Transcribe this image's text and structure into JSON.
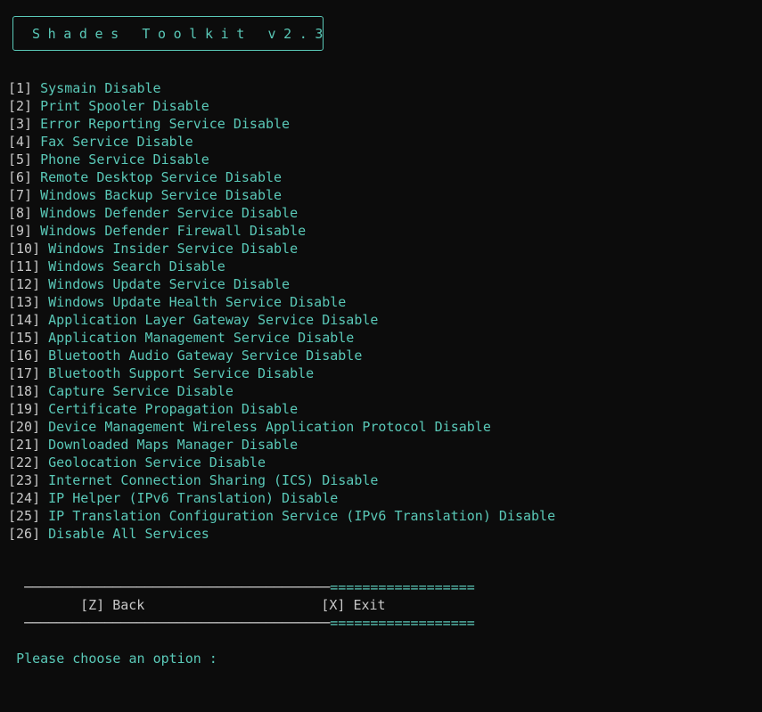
{
  "window": {
    "title": "Shades Toolkit v2.3"
  },
  "menu": {
    "items": [
      {
        "num": "[1]",
        "label": "Sysmain Disable"
      },
      {
        "num": "[2]",
        "label": "Print Spooler Disable"
      },
      {
        "num": "[3]",
        "label": "Error Reporting Service Disable"
      },
      {
        "num": "[4]",
        "label": "Fax Service Disable"
      },
      {
        "num": "[5]",
        "label": "Phone Service Disable"
      },
      {
        "num": "[6]",
        "label": "Remote Desktop Service Disable"
      },
      {
        "num": "[7]",
        "label": "Windows Backup Service Disable"
      },
      {
        "num": "[8]",
        "label": "Windows Defender Service Disable"
      },
      {
        "num": "[9]",
        "label": "Windows Defender Firewall Disable"
      },
      {
        "num": "[10]",
        "label": "Windows Insider Service Disable"
      },
      {
        "num": "[11]",
        "label": "Windows Search Disable"
      },
      {
        "num": "[12]",
        "label": "Windows Update Service Disable"
      },
      {
        "num": "[13]",
        "label": "Windows Update Health Service Disable"
      },
      {
        "num": "[14]",
        "label": "Application Layer Gateway Service Disable"
      },
      {
        "num": "[15]",
        "label": "Application Management Service Disable"
      },
      {
        "num": "[16]",
        "label": "Bluetooth Audio Gateway Service Disable"
      },
      {
        "num": "[17]",
        "label": "Bluetooth Support Service Disable"
      },
      {
        "num": "[18]",
        "label": "Capture Service Disable"
      },
      {
        "num": "[19]",
        "label": "Certificate Propagation Disable"
      },
      {
        "num": "[20]",
        "label": "Device Management Wireless Application Protocol Disable"
      },
      {
        "num": "[21]",
        "label": "Downloaded Maps Manager Disable"
      },
      {
        "num": "[22]",
        "label": "Geolocation Service Disable"
      },
      {
        "num": "[23]",
        "label": "Internet Connection Sharing (ICS) Disable"
      },
      {
        "num": "[24]",
        "label": "IP Helper (IPv6 Translation) Disable"
      },
      {
        "num": "[25]",
        "label": "IP Translation Configuration Service (IPv6 Translation) Disable"
      },
      {
        "num": "[26]",
        "label": "Disable All Services"
      }
    ]
  },
  "separator": {
    "dashes": "──────────────────────────────────────",
    "equals": "=================="
  },
  "nav": {
    "back_key": "[Z]",
    "back_label": "Back",
    "exit_key": "[X]",
    "exit_label": "Exit"
  },
  "prompt": {
    "text": "Please choose an option :"
  },
  "colors": {
    "background": "#0c0c0c",
    "accent": "#5ac9b8",
    "text": "#c8c8c8"
  }
}
